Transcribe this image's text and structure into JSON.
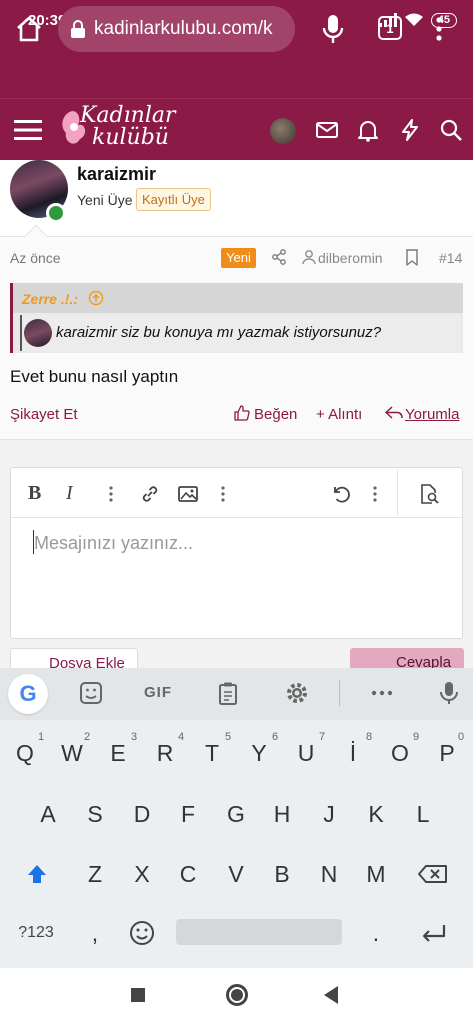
{
  "status_bar": {
    "time": "20:39",
    "battery": "45"
  },
  "browser": {
    "url": "kadinlarkulubu.com/k",
    "tab_count": "1"
  },
  "site": {
    "logo_line1": "Kadınlar",
    "logo_line2": "kulübü"
  },
  "post": {
    "username": "karaizmir",
    "role": "Yeni Üye",
    "badge": "Kayıtlı Üye",
    "time": "Az önce",
    "new_label": "Yeni",
    "reported_user": "dilberomin",
    "post_number": "#14",
    "quote_author": "Zerre .!.:",
    "quote_text": "karaizmir siz bu konuya mı yazmak istiyorsunuz?",
    "body": "Evet bunu nasıl yaptın",
    "actions": {
      "report": "Şikayet Et",
      "like": "Beğen",
      "quote": "+ Alıntı",
      "reply": "Yorumla"
    }
  },
  "editor": {
    "placeholder": "Mesajınızı yazınız...",
    "attach_label": "Dosya Ekle",
    "submit_label": "Cevapla",
    "toolbar": {
      "bold": "B",
      "italic": "I"
    }
  },
  "keyboard": {
    "suggest_gif": "GIF",
    "row1": [
      "Q",
      "W",
      "E",
      "R",
      "T",
      "Y",
      "U",
      "İ",
      "O",
      "P"
    ],
    "row1_hints": [
      "1",
      "2",
      "3",
      "4",
      "5",
      "6",
      "7",
      "8",
      "9",
      "0"
    ],
    "row2": [
      "A",
      "S",
      "D",
      "F",
      "G",
      "H",
      "J",
      "K",
      "L"
    ],
    "row3": [
      "Z",
      "X",
      "C",
      "V",
      "B",
      "N",
      "M"
    ],
    "symbols_key": "?123",
    "comma": ",",
    "period": "."
  },
  "colors": {
    "brand": "#8b1a46",
    "accent_orange": "#f08c1a",
    "online": "#2e9b3a"
  }
}
